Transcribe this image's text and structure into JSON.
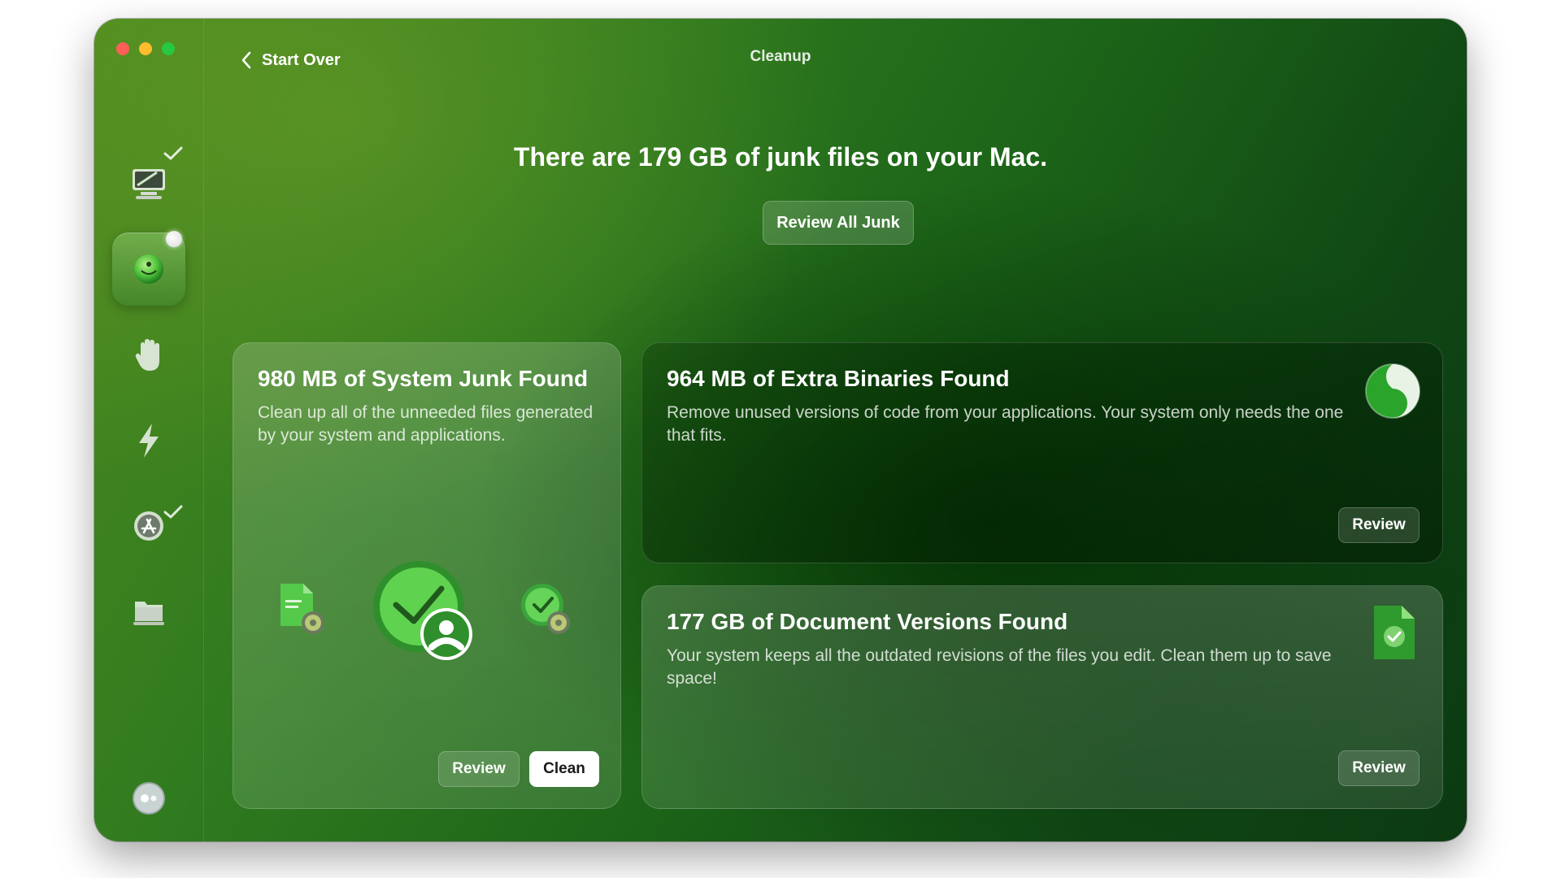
{
  "window": {
    "title": "Cleanup",
    "back_label": "Start Over"
  },
  "sidebar": {
    "items": [
      {
        "name": "smart-scan",
        "icon": "monitor-sweep-icon",
        "checked": true
      },
      {
        "name": "cleanup",
        "icon": "cleanup-orb-icon",
        "active": true
      },
      {
        "name": "protection",
        "icon": "hand-icon"
      },
      {
        "name": "performance",
        "icon": "lightning-icon"
      },
      {
        "name": "applications",
        "icon": "app-store-icon",
        "checked": true
      },
      {
        "name": "my-clutter",
        "icon": "folder-icon"
      }
    ],
    "assistant_icon": "assistant-icon"
  },
  "main": {
    "headline": "There are 179 GB of junk files on your Mac.",
    "review_all_label": "Review All Junk"
  },
  "cards": [
    {
      "title": "980 MB of System Junk Found",
      "description": "Clean up all of the unneeded files generated by your system and applications.",
      "review_label": "Review",
      "clean_label": "Clean"
    },
    {
      "title": "964 MB of Extra Binaries Found",
      "description": "Remove unused versions of code from your applications. Your system only needs the one that fits.",
      "review_label": "Review"
    },
    {
      "title": "177 GB of Document Versions Found",
      "description": "Your system keeps all the outdated revisions of the files you edit. Clean them up to save space!",
      "review_label": "Review"
    }
  ],
  "colors": {
    "close": "#ff5f57",
    "minimize": "#febc2e",
    "maximize": "#28c840",
    "icon_green": "#3fb53a"
  }
}
